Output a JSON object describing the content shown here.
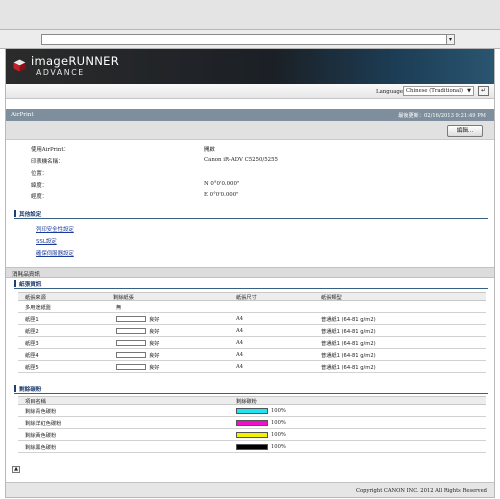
{
  "browser": {
    "address_value": "",
    "address_dropdown_icon": "chevron-down-icon"
  },
  "brand": {
    "name": "imageRUNNER",
    "sub": "ADVANCE",
    "logo_icon": "canon-cube-icon"
  },
  "language": {
    "label": "Language:",
    "selected": "Chinese (Traditional)",
    "go_icon": "return-icon"
  },
  "airprint": {
    "title": "AirPrint",
    "last_updated": "最後更新：02/16/2013 9:21:49 PM",
    "edit_label": "編輯...",
    "fields": [
      {
        "label": "使用AirPrint：",
        "value": "開啟"
      },
      {
        "label": "印表機名稱：",
        "value": "Canon iR-ADV C5250/5255"
      },
      {
        "label": "位置：",
        "value": ""
      },
      {
        "label": "緯度：",
        "value": "N 0°0'0.000\""
      },
      {
        "label": "經度：",
        "value": "E 0°0'0.000\""
      }
    ]
  },
  "other_settings": {
    "title": "其他設定",
    "links": [
      "列印安全性設定",
      "SSL設定",
      "確保伺服器設定"
    ]
  },
  "consumables": {
    "title": "消耗品資訊",
    "paper": {
      "title": "紙張資訊",
      "columns": [
        "紙張來源",
        "剩餘紙張",
        "紙張尺寸",
        "紙張類型"
      ],
      "rows": [
        {
          "source": "多用途紙盤",
          "remaining": "無",
          "size": "",
          "type": "",
          "bar": false
        },
        {
          "source": "紙匣1",
          "remaining": "良好",
          "size": "A4",
          "type": "普通紙1 (64-81 g/m2)",
          "bar": true
        },
        {
          "source": "紙匣2",
          "remaining": "良好",
          "size": "A4",
          "type": "普通紙1 (64-81 g/m2)",
          "bar": true
        },
        {
          "source": "紙匣3",
          "remaining": "良好",
          "size": "A4",
          "type": "普通紙1 (64-81 g/m2)",
          "bar": true
        },
        {
          "source": "紙匣4",
          "remaining": "良好",
          "size": "A4",
          "type": "普通紙1 (64-81 g/m2)",
          "bar": true
        },
        {
          "source": "紙匣5",
          "remaining": "良好",
          "size": "A4",
          "type": "普通紙1 (64-81 g/m2)",
          "bar": true
        }
      ]
    },
    "toner": {
      "title": "剩餘碳粉",
      "columns": [
        "項目名稱",
        "剩餘碳粉"
      ],
      "rows": [
        {
          "name": "剩餘青色碳粉",
          "level": "100%",
          "level_fraction": 1.0,
          "color": "#20e4f0"
        },
        {
          "name": "剩餘洋紅色碳粉",
          "level": "100%",
          "level_fraction": 1.0,
          "color": "#ee10cc"
        },
        {
          "name": "剩餘黃色碳粉",
          "level": "100%",
          "level_fraction": 1.0,
          "color": "#f2f200"
        },
        {
          "name": "剩餘黑色碳粉",
          "level": "100%",
          "level_fraction": 1.0,
          "color": "#000000"
        }
      ]
    }
  },
  "to_top_icon": "arrow-up-icon",
  "footer": "Copyright CANON INC. 2012 All Rights Reserved"
}
